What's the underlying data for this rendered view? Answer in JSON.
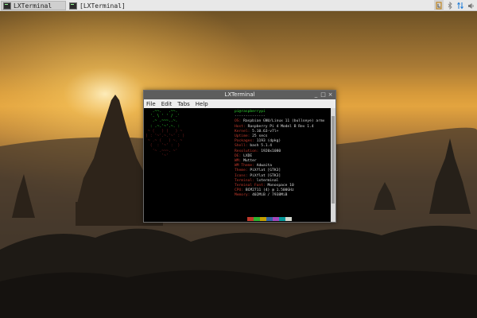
{
  "taskbar": {
    "tasks": [
      {
        "label": "LXTerminal",
        "active": true
      },
      {
        "label": "[LXTerminal]",
        "active": false
      }
    ],
    "tray": {
      "network_icon": "network-icon",
      "bluetooth_icon": "bluetooth-icon",
      "transfer_icon": "up-down-arrows-icon",
      "volume_icon": "volume-icon"
    }
  },
  "terminal": {
    "title": "LXTerminal",
    "controls": {
      "minimize": "_",
      "maximize": "□",
      "close": "×"
    },
    "menu": [
      "File",
      "Edit",
      "Tabs",
      "Help"
    ],
    "logo_lines": [
      "   .~~.   .~~.",
      "  '. \\ ' ' / .'",
      "   .~ .~~~..~.",
      "  : .~.'~'.~. :",
      " ~ (   ) (   ) ~",
      "( : '~'.~.'~' : )",
      " ~ .~ (   ) ~. ~",
      "  (  : '~' :  )",
      "   '~ .~~~. ~'",
      "       '~'"
    ],
    "logo_green_rows": 4,
    "prompt": "pi@raspberrypi",
    "separator": "--------------",
    "info": [
      {
        "key": "OS:",
        "value": "Raspbian GNU/Linux 11 (bullseye) armv"
      },
      {
        "key": "Host:",
        "value": "Raspberry Pi 4 Model B Rev 1.4"
      },
      {
        "key": "Kernel:",
        "value": "5.10.63-v7l+"
      },
      {
        "key": "Uptime:",
        "value": "25 secs"
      },
      {
        "key": "Packages:",
        "value": "1193 (dpkg)"
      },
      {
        "key": "Shell:",
        "value": "bash 5.1.4"
      },
      {
        "key": "Resolution:",
        "value": "1920x1080"
      },
      {
        "key": "DE:",
        "value": "LXDE"
      },
      {
        "key": "WM:",
        "value": "Mutter"
      },
      {
        "key": "WM Theme:",
        "value": "Adwaita"
      },
      {
        "key": "Theme:",
        "value": "PiXflat [GTK3]"
      },
      {
        "key": "Icons:",
        "value": "PiXflat [GTK3]"
      },
      {
        "key": "Terminal:",
        "value": "lxterminal"
      },
      {
        "key": "Terminal Font:",
        "value": "Monospace 10"
      },
      {
        "key": "CPU:",
        "value": "BCM2711 (4) @ 1.500GHz"
      },
      {
        "key": "Memory:",
        "value": "402MiB / 7938MiB"
      }
    ],
    "palette": [
      "#000000",
      "#c0392b",
      "#2fb32f",
      "#c4a000",
      "#3465a4",
      "#a347ba",
      "#06989a",
      "#d3d7cf"
    ]
  },
  "colors": {
    "taskbar_bg": "#e8e8e8",
    "terminal_bg": "#000000",
    "logo_green": "#2fd02f",
    "info_key": "#c0392b"
  }
}
